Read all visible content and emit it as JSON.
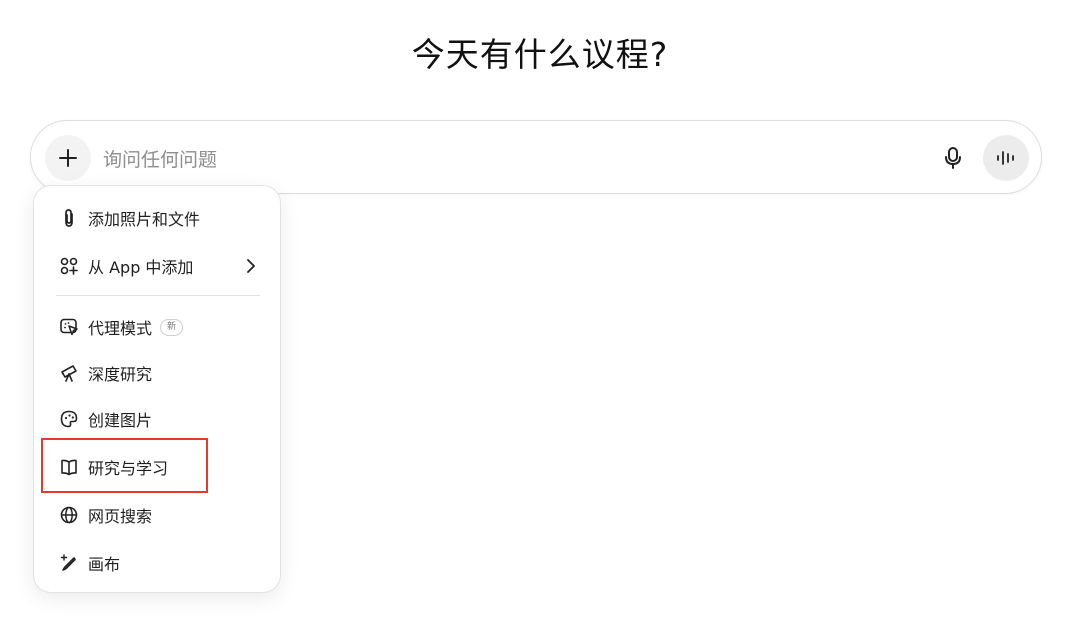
{
  "heading": "今天有什么议程?",
  "composer": {
    "placeholder": "询问任何问题",
    "plus_icon": "plus-icon",
    "mic_icon": "microphone-icon",
    "voice_icon": "voice-waveform-icon"
  },
  "menu": {
    "items": [
      {
        "label": "添加照片和文件",
        "icon": "paperclip-icon"
      },
      {
        "label": "从 App 中添加",
        "icon": "apps-icon",
        "has_submenu": true
      },
      {
        "label": "代理模式",
        "icon": "agent-cursor-icon",
        "badge": "新"
      },
      {
        "label": "深度研究",
        "icon": "telescope-icon"
      },
      {
        "label": "创建图片",
        "icon": "palette-icon"
      },
      {
        "label": "研究与学习",
        "icon": "book-icon",
        "highlighted": true
      },
      {
        "label": "网页搜索",
        "icon": "globe-icon"
      },
      {
        "label": "画布",
        "icon": "pen-sparkle-icon"
      }
    ]
  },
  "colors": {
    "highlight": "#e53a2f",
    "placeholder": "#8e8e8e",
    "button_bg": "#ececec"
  }
}
